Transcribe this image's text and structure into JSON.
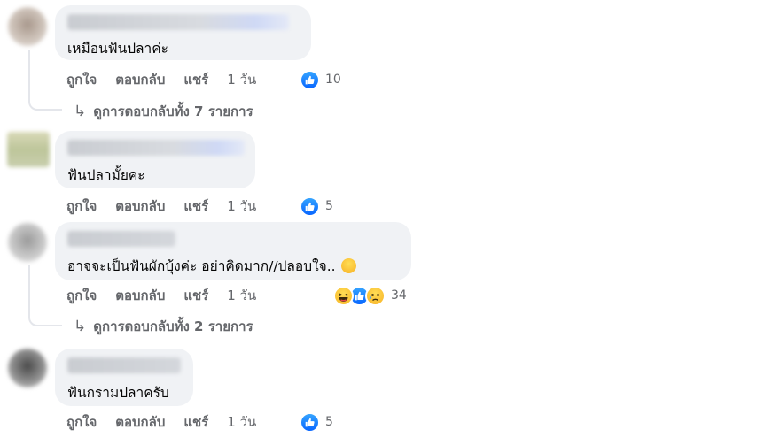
{
  "comments": [
    {
      "text": "เหมือนฟันปลาค่ะ",
      "actions": {
        "like": "ถูกใจ",
        "reply": "ตอบกลับ",
        "share": "แชร์",
        "time": "1 วัน"
      },
      "reaction_count": "10",
      "reactions": [
        "like-icon"
      ],
      "view_replies": "ดูการตอบกลับทั้ง 7 รายการ"
    },
    {
      "text": "ฟันปลามั้ยคะ",
      "actions": {
        "like": "ถูกใจ",
        "reply": "ตอบกลับ",
        "share": "แชร์",
        "time": "1 วัน"
      },
      "reaction_count": "5",
      "reactions": [
        "like-icon"
      ]
    },
    {
      "text": "อาจจะเป็นฟันผักบุ้งค่ะ อย่าคิดมาก//ปลอบใจ..",
      "actions": {
        "like": "ถูกใจ",
        "reply": "ตอบกลับ",
        "share": "แชร์",
        "time": "1 วัน"
      },
      "reaction_count": "34",
      "reactions": [
        "haha-icon",
        "like-icon",
        "sad-icon"
      ],
      "view_replies": "ดูการตอบกลับทั้ง 2 รายการ"
    },
    {
      "text": "ฟันกรามปลาครับ",
      "actions": {
        "like": "ถูกใจ",
        "reply": "ตอบกลับ",
        "share": "แชร์",
        "time": "1 วัน"
      },
      "reaction_count": "5",
      "reactions": [
        "like-icon"
      ]
    }
  ],
  "colors": {
    "like_blue": "#0866ff",
    "bubble_bg": "#f0f2f5",
    "secondary_text": "#65676b"
  }
}
